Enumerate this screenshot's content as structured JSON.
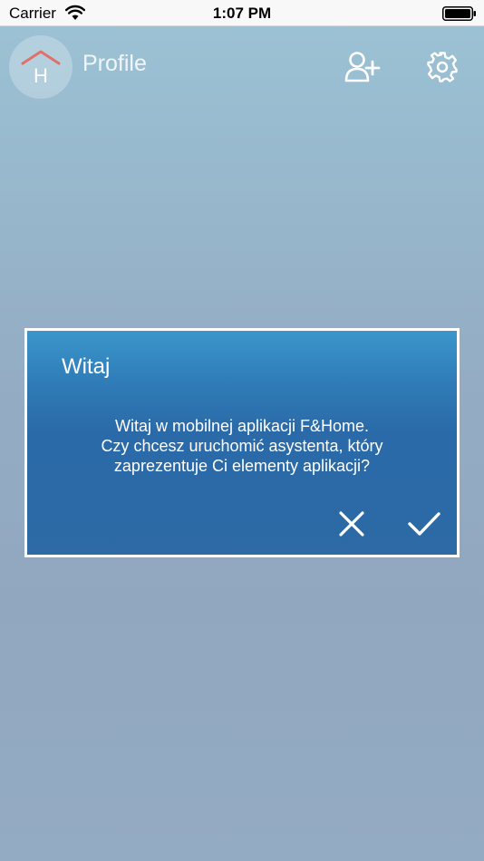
{
  "status_bar": {
    "carrier": "Carrier",
    "time": "1:07 PM",
    "wifi_icon": "wifi-icon",
    "battery_icon": "battery-full-icon"
  },
  "header": {
    "logo_icon": "home-logo-icon",
    "logo_letter": "H",
    "title": "Profile",
    "add_user_icon": "add-user-icon",
    "settings_icon": "gear-icon"
  },
  "dialog": {
    "title": "Witaj",
    "message_lines": [
      "Witaj w mobilnej aplikacji F&Home.",
      "Czy chcesz uruchomić asystenta, który",
      "zaprezentuje Ci elementy aplikacji?"
    ],
    "cancel_icon": "close-icon",
    "confirm_icon": "checkmark-icon"
  },
  "colors": {
    "dialog_top": "#3a96cb",
    "dialog_bottom": "#2d6aa6",
    "logo_roof": "#e0706a",
    "background_top": "#9cc3d5",
    "background_bottom": "#93abc3"
  }
}
